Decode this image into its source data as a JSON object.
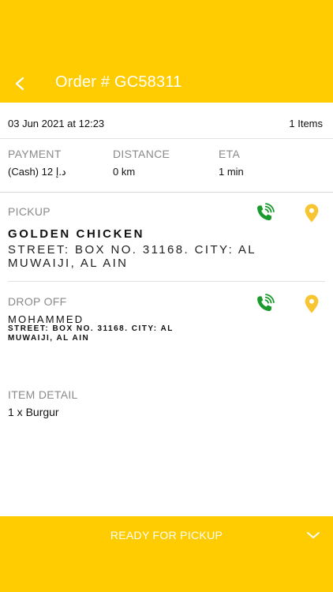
{
  "header": {
    "title": "Order # GC58311",
    "back_icon": "back-arrow-icon",
    "background": "#fecc00"
  },
  "order_meta": {
    "date": "03 Jun 2021 at 12:23",
    "items_count": "1 Items"
  },
  "stats": {
    "payment": {
      "label": "PAYMENT",
      "value": "(Cash) 12 د.إ"
    },
    "distance": {
      "label": "DISTANCE",
      "value": "0 km"
    },
    "eta": {
      "label": "ETA",
      "value": "1 min"
    }
  },
  "pickup": {
    "label": "PICKUP",
    "name": "GOLDEN CHICKEN",
    "address": "STREET: BOX NO. 31168. CITY: AL MUWAIJI, AL AIN",
    "call_icon": "phone-call-icon",
    "location_icon": "location-pin-icon"
  },
  "dropoff": {
    "label": "DROP OFF",
    "name": "MOHAMMED",
    "address": "STREET: BOX NO. 31168. CITY: AL MUWAIJI, AL AIN",
    "call_icon": "phone-call-icon",
    "location_icon": "location-pin-icon"
  },
  "item_detail": {
    "label": "ITEM DETAIL",
    "items": [
      "1 x Burgur"
    ]
  },
  "footer": {
    "action_label": "READY FOR PICKUP",
    "chevron_icon": "chevron-down-icon"
  },
  "colors": {
    "accent": "#fecc00",
    "call_green": "#1a9a2c",
    "pin_yellow": "#f7c531",
    "muted_label": "#8a8a8a"
  }
}
